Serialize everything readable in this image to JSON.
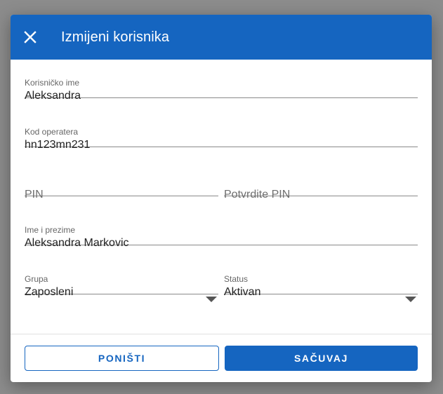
{
  "dialog": {
    "title": "Izmijeni korisnika",
    "close_icon": "close-icon"
  },
  "form": {
    "username": {
      "label": "Korisničko ime",
      "value": "Aleksandra"
    },
    "operator_code": {
      "label": "Kod operatera",
      "value": "hn123mn231"
    },
    "pin": {
      "placeholder": "PIN"
    },
    "confirm_pin": {
      "placeholder": "Potvrdite PIN"
    },
    "full_name": {
      "label": "Ime i prezime",
      "value": "Aleksandra Markovic"
    },
    "group": {
      "label": "Grupa",
      "value": "Zaposleni"
    },
    "status": {
      "label": "Status",
      "value": "Aktivan"
    }
  },
  "actions": {
    "cancel_label": "PONIŠTI",
    "save_label": "SAČUVAJ"
  },
  "colors": {
    "primary": "#1565c0",
    "overlay": "#8c8c8c"
  }
}
